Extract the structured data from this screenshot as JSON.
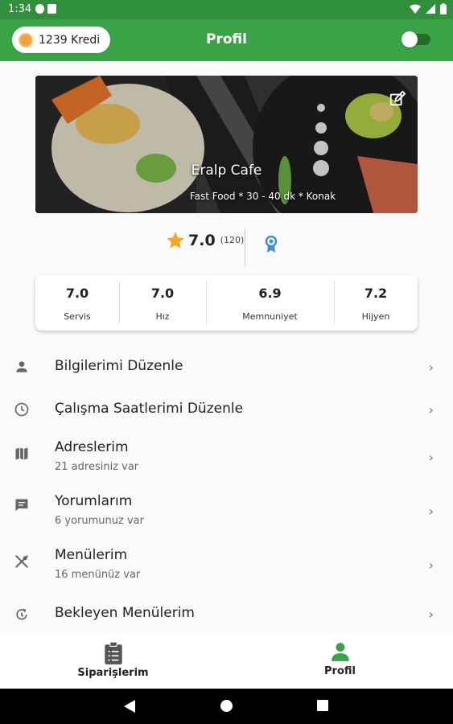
{
  "status_bar": {
    "time": "1:34"
  },
  "app_bar": {
    "credit_label": "1239 Kredi",
    "title": "Profil"
  },
  "hero": {
    "name": "Eralp Cafe",
    "subtitle": "Fast Food * 30 - 40 dk * Konak"
  },
  "rating": {
    "value": "7.0",
    "count": "(120)"
  },
  "scores": [
    {
      "value": "7.0",
      "label": "Servis"
    },
    {
      "value": "7.0",
      "label": "Hız"
    },
    {
      "value": "6.9",
      "label": "Memnuniyet"
    },
    {
      "value": "7.2",
      "label": "Hijyen"
    }
  ],
  "menu": [
    {
      "label": "Bilgilerimi Düzenle",
      "sub": "",
      "icon": "person-icon"
    },
    {
      "label": "Çalışma Saatlerimi Düzenle",
      "sub": "",
      "icon": "clock-icon"
    },
    {
      "label": "Adreslerim",
      "sub": "21 adresiniz var",
      "icon": "map-icon"
    },
    {
      "label": "Yorumlarım",
      "sub": "6 yorumunuz var",
      "icon": "comment-icon"
    },
    {
      "label": "Menülerim",
      "sub": "16 menünüz var",
      "icon": "utensils-icon"
    },
    {
      "label": "Bekleyen Menülerim",
      "sub": "",
      "icon": "refresh-clock-icon"
    }
  ],
  "bottom_nav": {
    "orders_label": "Siparişlerim",
    "profile_label": "Profil"
  },
  "colors": {
    "primary": "#3aa346",
    "status_bar": "#2f8f3b",
    "star": "#f6a623",
    "badge": "#3b8fd9"
  }
}
